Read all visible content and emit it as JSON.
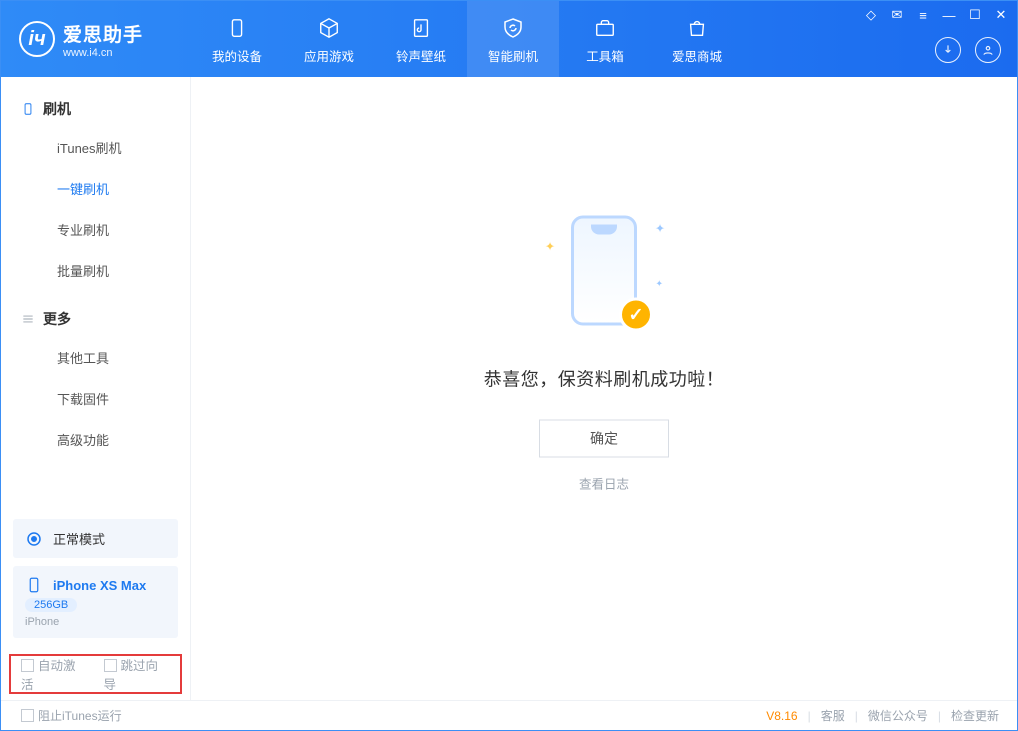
{
  "app": {
    "name": "爱思助手",
    "url": "www.i4.cn"
  },
  "nav": [
    {
      "label": "我的设备"
    },
    {
      "label": "应用游戏"
    },
    {
      "label": "铃声壁纸"
    },
    {
      "label": "智能刷机"
    },
    {
      "label": "工具箱"
    },
    {
      "label": "爱思商城"
    }
  ],
  "active_nav_index": 3,
  "sidebar": {
    "group1_title": "刷机",
    "group1_items": [
      "iTunes刷机",
      "一键刷机",
      "专业刷机",
      "批量刷机"
    ],
    "group1_active_index": 1,
    "group2_title": "更多",
    "group2_items": [
      "其他工具",
      "下载固件",
      "高级功能"
    ]
  },
  "device_mode": "正常模式",
  "device": {
    "name": "iPhone XS Max",
    "capacity": "256GB",
    "type": "iPhone"
  },
  "options": {
    "auto_activate": "自动激活",
    "skip_guide": "跳过向导"
  },
  "result": {
    "message": "恭喜您，保资料刷机成功啦！",
    "ok": "确定",
    "log": "查看日志"
  },
  "footer": {
    "block_itunes": "阻止iTunes运行",
    "version": "V8.16",
    "links": [
      "客服",
      "微信公众号",
      "检查更新"
    ]
  }
}
